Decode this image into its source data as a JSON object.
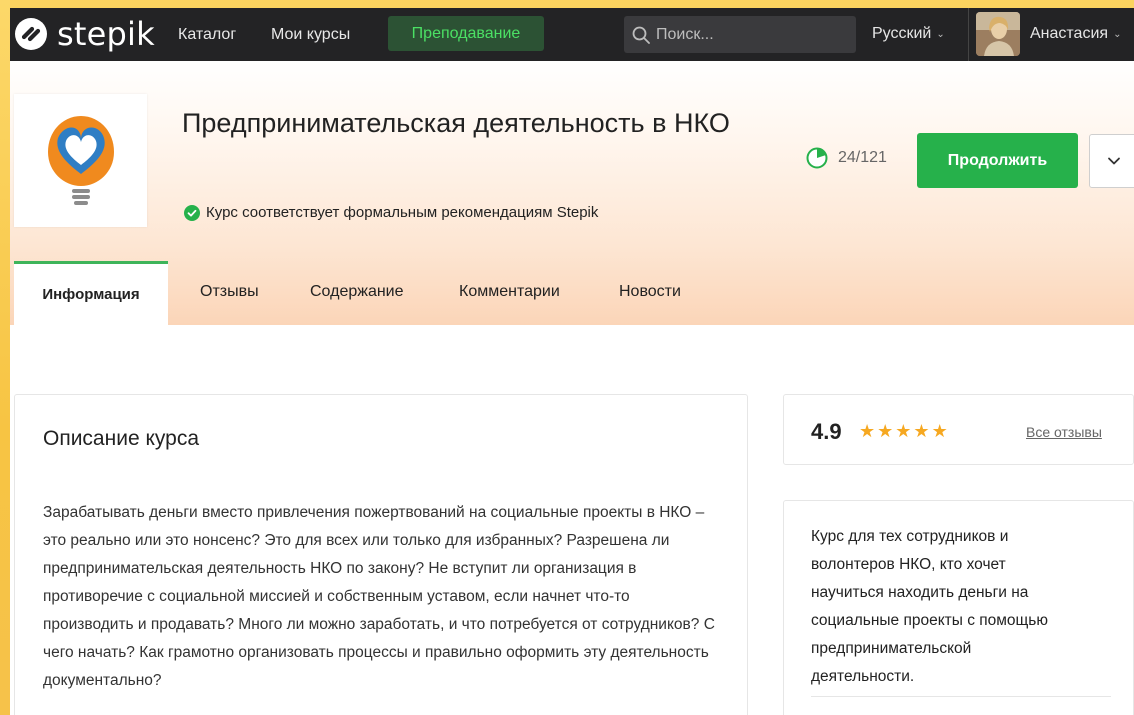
{
  "nav": {
    "brand": "stepik",
    "catalog": "Каталог",
    "my_courses": "Мои курсы",
    "teaching": "Преподавание",
    "search_placeholder": "Поиск...",
    "language": "Русский",
    "user_name": "Анастасия"
  },
  "course": {
    "title": "Предпринимательская деятельность в НКО",
    "verified_text": "Курс соответствует формальным рекомендациям Stepik",
    "progress_text": "24/121",
    "progress_fraction": 0.198,
    "continue_label": "Продолжить"
  },
  "tabs": {
    "info": "Информация",
    "reviews": "Отзывы",
    "contents": "Содержание",
    "comments": "Комментарии",
    "news": "Новости"
  },
  "description": {
    "title": "Описание курса",
    "body": "Зарабатывать деньги вместо привлечения пожертвований на социальные проекты в НКО – это реально или это нонсенс? Это для всех или только для избранных? Разрешена ли предпринимательская деятельность НКО по закону? Не вступит ли организация в противоречие с социальной миссией и собственным уставом, если начнет что-то производить и продавать? Много ли можно заработать, и что потребуется от сотрудников? С чего начать? Как грамотно организовать процессы и правильно оформить эту деятельность документально?"
  },
  "rating": {
    "value": "4.9",
    "stars": 5,
    "all_reviews": "Все отзывы"
  },
  "summary": {
    "text": "Курс для тех сотрудников и волонтеров НКО, кто хочет научиться находить деньги на социальные проекты с помощью предпринимательской деятельности."
  },
  "colors": {
    "nav_bg": "#232325",
    "accent_green": "#26b14b",
    "teach_text": "#4be064",
    "star": "#f6a821",
    "frame": "#fbc84a"
  }
}
